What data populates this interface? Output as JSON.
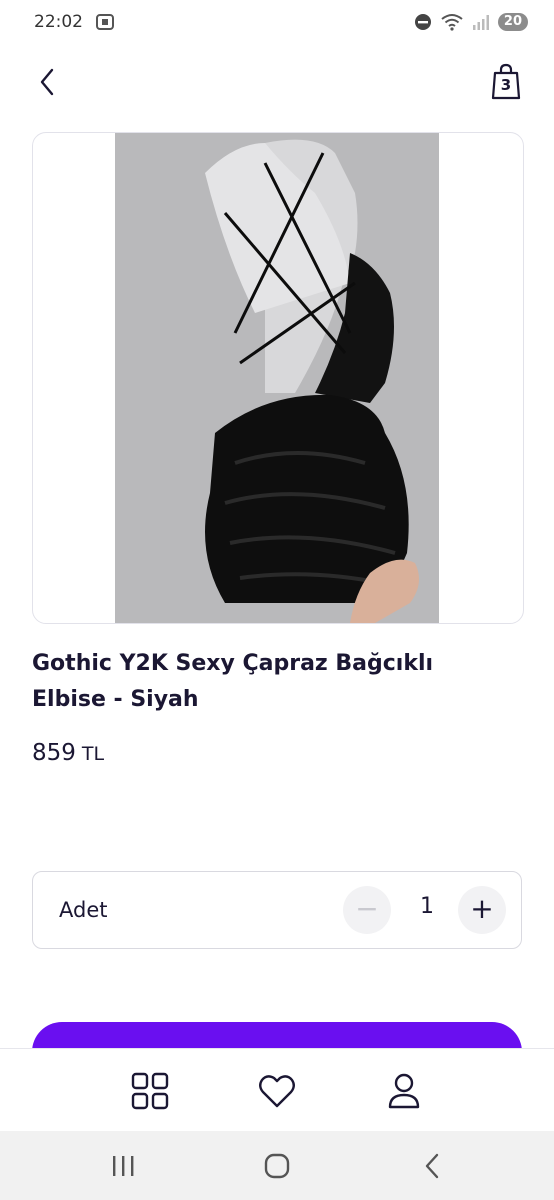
{
  "status_bar": {
    "time": "22:02",
    "battery": "20"
  },
  "header": {
    "cart_count": "3"
  },
  "product": {
    "title": "Gothic Y2K Sexy Çapraz Bağcıklı Elbise - Siyah",
    "price": "859",
    "currency": "TL"
  },
  "quantity": {
    "label": "Adet",
    "value": "1",
    "minus": "−",
    "plus": "+"
  },
  "colors": {
    "accent": "#6a0ff0",
    "text": "#1b1733"
  },
  "icons": {
    "back": "chevron-left-icon",
    "cart": "shopping-bag-icon",
    "nav": [
      "grid-icon",
      "heart-icon",
      "user-icon"
    ],
    "system": [
      "recent-apps-icon",
      "home-icon",
      "back-icon"
    ]
  }
}
